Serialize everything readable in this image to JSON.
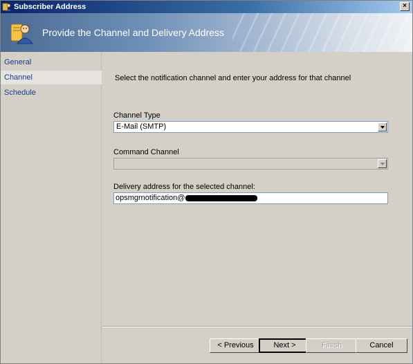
{
  "window": {
    "title": "Subscriber Address",
    "close_glyph": "×"
  },
  "banner": {
    "title": "Provide the Channel and Delivery Address",
    "icon": "subscriber-icon"
  },
  "sidebar": {
    "items": [
      {
        "label": "General",
        "active": false
      },
      {
        "label": "Channel",
        "active": true
      },
      {
        "label": "Schedule",
        "active": false
      }
    ]
  },
  "main": {
    "instruction": "Select the notification channel and enter your address for that channel",
    "channel_type": {
      "label": "Channel Type",
      "value": "E-Mail (SMTP)"
    },
    "command_channel": {
      "label": "Command Channel",
      "value": "",
      "enabled": false
    },
    "delivery_address": {
      "label": "Delivery address for the selected channel:",
      "value_prefix": "opsmgrnotification@"
    }
  },
  "buttons": {
    "previous": "< Previous",
    "next": "Next >",
    "finish": "Finish",
    "cancel": "Cancel"
  },
  "colors": {
    "title_bar": "#0a246a",
    "link_text": "#1a3c8c",
    "selected_nav": "#e6e4de"
  }
}
